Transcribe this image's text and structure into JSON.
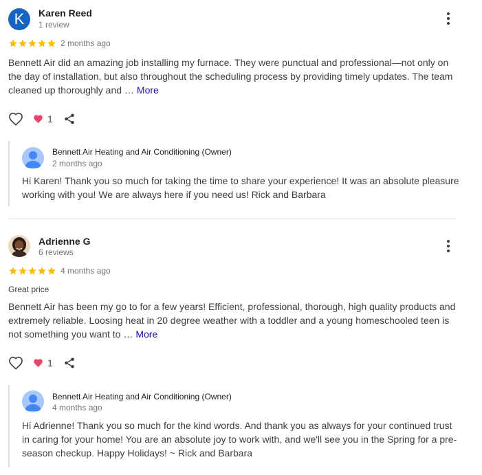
{
  "reviews": [
    {
      "avatar_letter": "K",
      "avatar_color": "#1565c0",
      "name": "Karen Reed",
      "review_count": "1 review",
      "rating": 5,
      "time": "2 months ago",
      "text": "Bennett Air did an amazing job installing my furnace. They were punctual and professional—not only on the day of installation, but also throughout the scheduling process by providing timely updates. The team cleaned up thoroughly and …",
      "more_label": "More",
      "like_count": "1",
      "reply": {
        "owner": "Bennett Air Heating and Air Conditioning (Owner)",
        "time": "2 months ago",
        "text": "Hi Karen! Thank you so much for taking the time to share your experience! It was an absolute pleasure working with you! We are always here if you need us! Rick and Barbara"
      }
    },
    {
      "name": "Adrienne G",
      "review_count": "6 reviews",
      "rating": 5,
      "time": "4 months ago",
      "tag": "Great price",
      "text": "Bennett Air has been my go to for a few years! Efficient, professional, thorough, high quality products and extremely reliable. Loosing heat in 20 degree weather with a toddler and a young homeschooled teen is not something you want to …",
      "more_label": "More",
      "like_count": "1",
      "reply": {
        "owner": "Bennett Air Heating and Air Conditioning (Owner)",
        "time": "4 months ago",
        "text": "Hi Adrienne! Thank you so much for the kind words. And thank you as always for your continued trust in caring for your home! You are an absolute joy to work with, and we'll see you in the Spring for a pre-season checkup. Happy Holidays! ~ Rick and Barbara"
      }
    }
  ],
  "colors": {
    "star": "#fbbc04",
    "heart": "#e8446a",
    "link": "#1a0dab"
  }
}
